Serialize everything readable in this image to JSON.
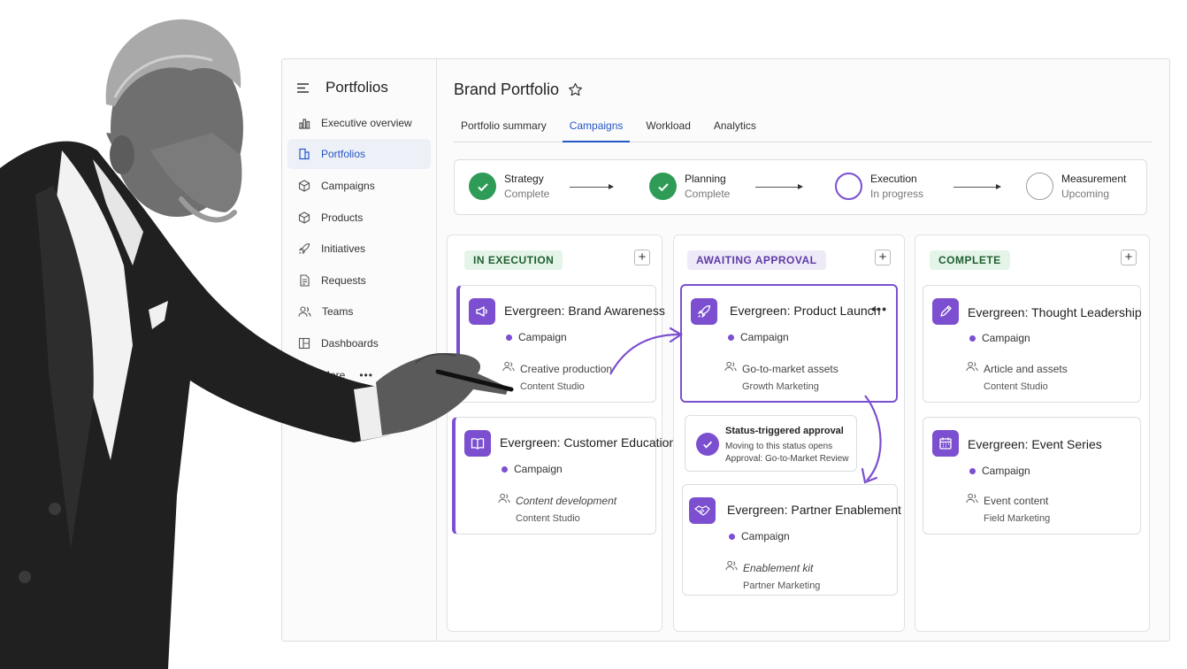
{
  "sidebar": {
    "title": "Portfolios",
    "items": [
      {
        "label": "Executive overview",
        "icon": "bar-chart-icon"
      },
      {
        "label": "Portfolios",
        "icon": "portfolio-icon"
      },
      {
        "label": "Campaigns",
        "icon": "campaign-icon"
      },
      {
        "label": "Products",
        "icon": "box-icon"
      },
      {
        "label": "Initiatives",
        "icon": "rocket-icon"
      },
      {
        "label": "Requests",
        "icon": "document-icon"
      },
      {
        "label": "Teams",
        "icon": "people-icon"
      },
      {
        "label": "Dashboards",
        "icon": "dashboard-icon"
      },
      {
        "label": "More",
        "icon": "ellipsis-icon"
      }
    ],
    "active_index": 1
  },
  "header": {
    "title": "Brand Portfolio",
    "tabs": [
      "Portfolio summary",
      "Campaigns",
      "Workload",
      "Analytics"
    ],
    "active_tab": "Campaigns"
  },
  "stepper": [
    {
      "name": "Strategy",
      "status": "Complete"
    },
    {
      "name": "Planning",
      "status": "Complete"
    },
    {
      "name": "Execution",
      "status": "In progress"
    },
    {
      "name": "Measurement",
      "status": "Upcoming"
    }
  ],
  "columns": [
    {
      "label": "IN EXECUTION",
      "cards": [
        {
          "title": "Evergreen: Brand Awareness",
          "type": "Campaign",
          "work": "Creative production",
          "team": "Content Studio",
          "icon": "megaphone-icon"
        },
        {
          "title": "Evergreen: Customer Education",
          "type": "Campaign",
          "work": "Content development",
          "team": "Content Studio",
          "icon": "book-icon"
        }
      ]
    },
    {
      "label": "AWAITING APPROVAL",
      "cards": [
        {
          "title": "Evergreen: Product Launch",
          "type": "Campaign",
          "work": "Go-to-market assets",
          "team": "Growth Marketing",
          "icon": "rocket-icon"
        },
        {
          "title": "Evergreen: Partner Enablement",
          "type": "Campaign",
          "work": "Enablement kit",
          "team": "Partner Marketing",
          "icon": "handshake-icon"
        }
      ],
      "approval": {
        "title": "Status-triggered approval",
        "line1": "Moving to this status opens",
        "line2": "Approval: Go-to-Market Review"
      }
    },
    {
      "label": "COMPLETE",
      "cards": [
        {
          "title": "Evergreen: Thought Leadership",
          "type": "Campaign",
          "work": "Article and assets",
          "team": "Content Studio",
          "icon": "pencil-icon"
        },
        {
          "title": "Evergreen: Event Series",
          "type": "Campaign",
          "work": "Event content",
          "team": "Field Marketing",
          "icon": "calendar-icon"
        }
      ]
    }
  ],
  "colors": {
    "accent_purple": "#7b4fcf",
    "active_blue": "#2457c5",
    "complete_green": "#2e9c57"
  }
}
